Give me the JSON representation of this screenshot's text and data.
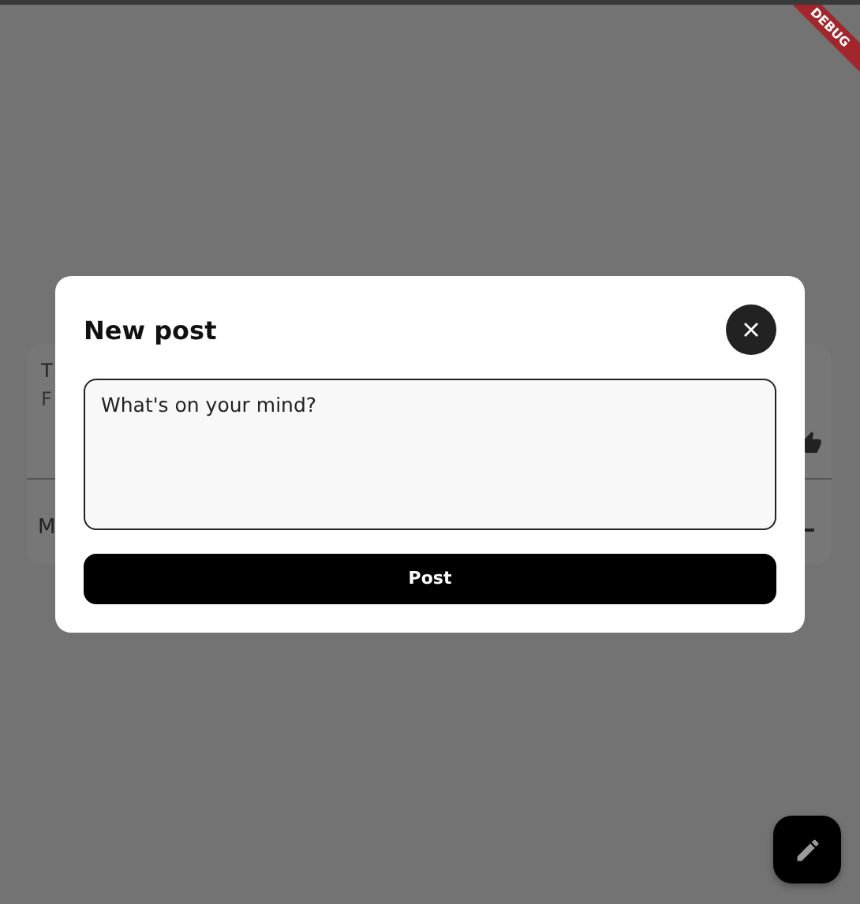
{
  "debug_banner": {
    "label": "DEBUG"
  },
  "background_card": {
    "title": "T",
    "subtitle": "F",
    "footer": "M"
  },
  "dialog": {
    "title": "New post",
    "input": {
      "placeholder": "What's on your mind?"
    },
    "submit": "Post"
  }
}
